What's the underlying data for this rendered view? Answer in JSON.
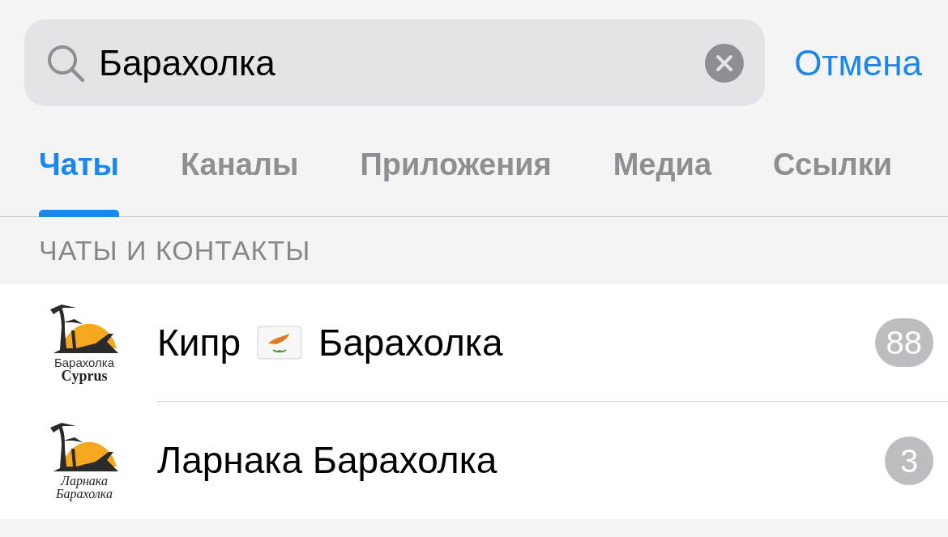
{
  "search": {
    "value": "Барахолка",
    "cancel": "Отмена"
  },
  "tabs": [
    {
      "label": "Чаты",
      "selected": true
    },
    {
      "label": "Каналы",
      "selected": false
    },
    {
      "label": "Приложения",
      "selected": false
    },
    {
      "label": "Медиа",
      "selected": false
    },
    {
      "label": "Ссылки",
      "selected": false
    }
  ],
  "section_header": "ЧАТЫ И КОНТАКТЫ",
  "chats": [
    {
      "title_before": "Кипр",
      "flag": true,
      "title_after": "Барахолка",
      "avatar_caption": [
        "Барахолка",
        "Cyprus"
      ],
      "kind": "plain",
      "badge": "88"
    },
    {
      "title_before": "Ларнака Барахолка",
      "flag": false,
      "avatar_caption": [
        "Ларнака",
        "Барахолка"
      ],
      "kind": "script",
      "badge": "3"
    }
  ]
}
